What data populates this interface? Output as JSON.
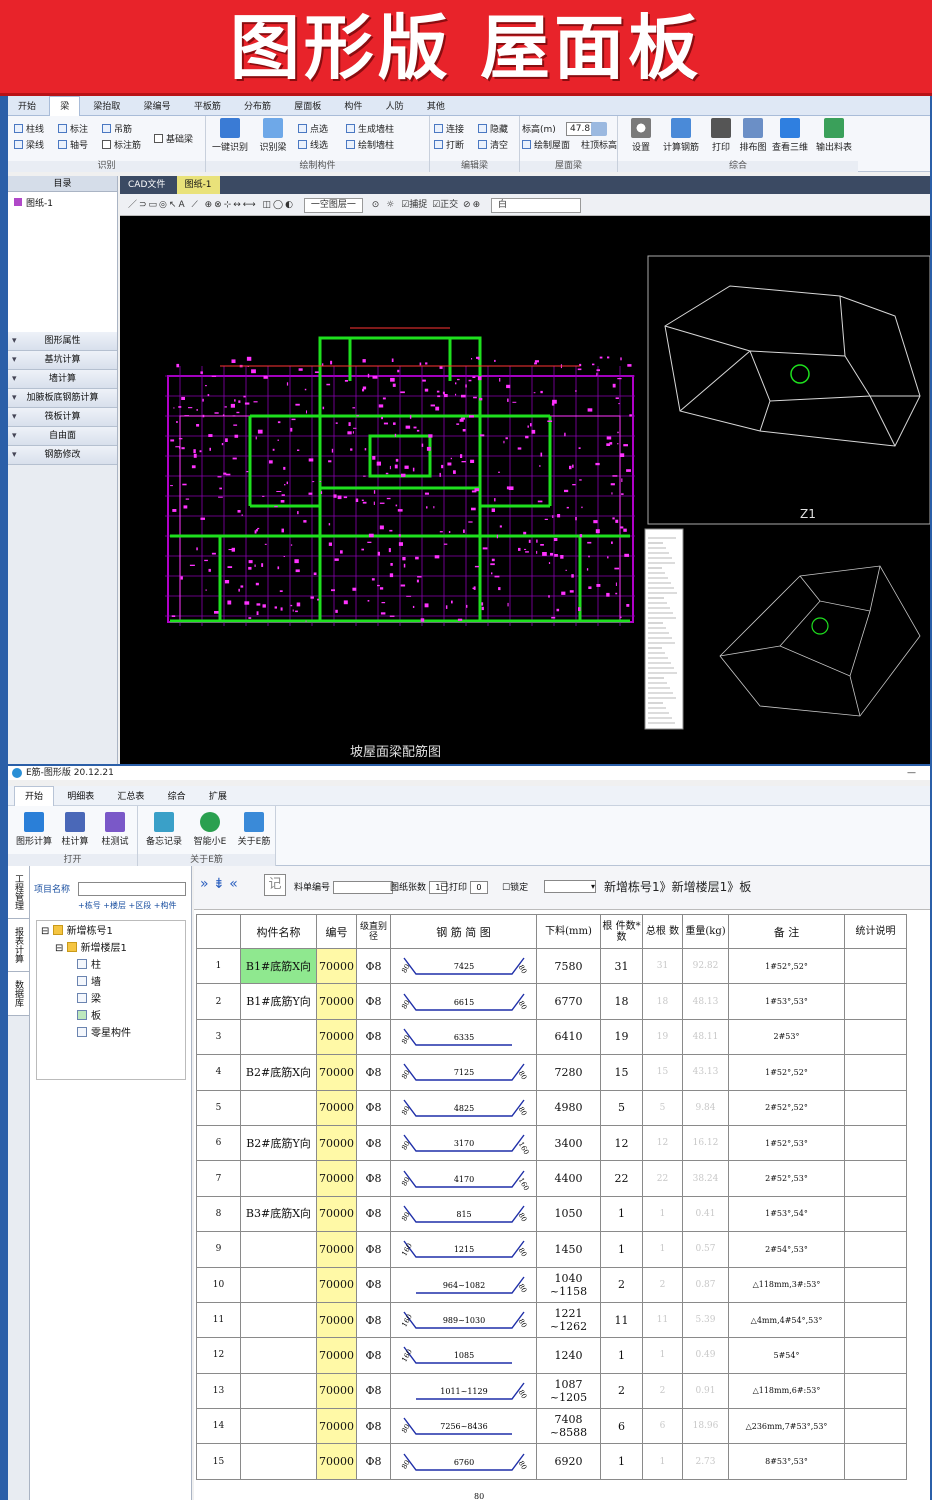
{
  "banner": {
    "title": "图形版  屋面板"
  },
  "top": {
    "menu": [
      "开始",
      "梁",
      "梁抬取",
      "梁编号",
      "平板筋",
      "分布筋",
      "屋面板",
      "构件",
      "人防",
      "其他"
    ],
    "menu_active": 1,
    "ribbon": {
      "recognize": {
        "label": "识别",
        "items": [
          "柱线",
          "标注",
          "吊筋",
          "基础梁",
          "梁线",
          "轴号",
          "标注筋"
        ]
      },
      "draw": {
        "label": "绘制构件",
        "items": [
          "一键识别",
          "识别梁",
          "点选",
          "线选",
          "生成墙柱",
          "绘制墙柱"
        ]
      },
      "edit": {
        "label": "编辑梁",
        "items": [
          "连接",
          "打断",
          "隐藏",
          "清空"
        ]
      },
      "roof": {
        "label": "屋面梁",
        "items": [
          "标高(m)",
          "47.8",
          "绘制屋面",
          "柱顶标高"
        ]
      },
      "combo": {
        "label": "综合",
        "items": [
          "设置",
          "计算钢筋",
          "打印",
          "排布图",
          "查看三维",
          "输出料表"
        ]
      }
    },
    "left_panel": {
      "header": "目录",
      "tree_item": "图纸-1",
      "sections": [
        "图形属性",
        "基坑计算",
        "墙计算",
        "加腋板底钢筋计算",
        "筏板计算",
        "自由面",
        "钢筋修改"
      ]
    },
    "doc_tabs": [
      "CAD文件",
      "图纸-1"
    ],
    "cad_toolbar": {
      "layer": "一空图层一",
      "snap": "捕捉",
      "ortho": "正交",
      "color": "白"
    },
    "drawing_caption": "坡屋面梁配筋图",
    "view_label": "Z1"
  },
  "bottom": {
    "title": "E筋-图形版 20.12.21",
    "menu": [
      "开始",
      "明细表",
      "汇总表",
      "综合",
      "扩展"
    ],
    "ribbon": {
      "open": {
        "label": "打开",
        "items": [
          "图形计算",
          "柱计算",
          "柱测试"
        ]
      },
      "about": {
        "label": "关于E筋",
        "items": [
          "备忘记录",
          "智能小E",
          "关于E筋"
        ]
      }
    },
    "vtabs": [
      "工程管理",
      "报表计算",
      "数据库"
    ],
    "project": {
      "label": "项目名称",
      "links": "+栋号 +楼层 +区段 +构件"
    },
    "tree": [
      "新增栋号1",
      "新增楼层1",
      "柱",
      "墙",
      "梁",
      "板",
      "零星构件"
    ],
    "grid_toolbar": {
      "material_no": "料单编号",
      "print_count_label": "图纸张数",
      "print_count": "1",
      "printed_label": "已打印",
      "printed": "0",
      "lock": "锁定",
      "record": "记",
      "crumb": "新增栋号1》新增楼层1》板"
    },
    "columns": [
      "构件名称",
      "编号",
      "级直别径",
      "钢 筋 简 图",
      "下料(mm)",
      "根 件数*数",
      "总根 数",
      "重量(kg)",
      "备  注",
      "统计说明"
    ],
    "rows": [
      {
        "idx": "1",
        "name": "B1#底筋X向",
        "code": "70000",
        "grade": "Φ8",
        "dims": [
          "80",
          "7425",
          "80"
        ],
        "len": "7580",
        "cnt": "31",
        "total": "31",
        "wt": "92.82",
        "note": "1#52°,52°"
      },
      {
        "idx": "2",
        "name": "B1#底筋Y向",
        "code": "70000",
        "grade": "Φ8",
        "dims": [
          "80",
          "6615",
          "80"
        ],
        "len": "6770",
        "cnt": "18",
        "total": "18",
        "wt": "48.13",
        "note": "1#53°,53°"
      },
      {
        "idx": "3",
        "name": "",
        "code": "70000",
        "grade": "Φ8",
        "dims": [
          "80",
          "6335",
          ""
        ],
        "len": "6410",
        "cnt": "19",
        "total": "19",
        "wt": "48.11",
        "note": "2#53°"
      },
      {
        "idx": "4",
        "name": "B2#底筋X向",
        "code": "70000",
        "grade": "Φ8",
        "dims": [
          "80",
          "7125",
          "80"
        ],
        "len": "7280",
        "cnt": "15",
        "total": "15",
        "wt": "43.13",
        "note": "1#52°,52°"
      },
      {
        "idx": "5",
        "name": "",
        "code": "70000",
        "grade": "Φ8",
        "dims": [
          "80",
          "4825",
          "80"
        ],
        "len": "4980",
        "cnt": "5",
        "total": "5",
        "wt": "9.84",
        "note": "2#52°,52°"
      },
      {
        "idx": "6",
        "name": "B2#底筋Y向",
        "code": "70000",
        "grade": "Φ8",
        "dims": [
          "80",
          "3170",
          "160"
        ],
        "len": "3400",
        "cnt": "12",
        "total": "12",
        "wt": "16.12",
        "note": "1#52°,53°"
      },
      {
        "idx": "7",
        "name": "",
        "code": "70000",
        "grade": "Φ8",
        "dims": [
          "80",
          "4170",
          "160"
        ],
        "len": "4400",
        "cnt": "22",
        "total": "22",
        "wt": "38.24",
        "note": "2#52°,53°"
      },
      {
        "idx": "8",
        "name": "B3#底筋X向",
        "code": "70000",
        "grade": "Φ8",
        "dims": [
          "80",
          "815",
          "80"
        ],
        "len": "1050",
        "cnt": "1",
        "total": "1",
        "wt": "0.41",
        "note": "1#53°,54°"
      },
      {
        "idx": "9",
        "name": "",
        "code": "70000",
        "grade": "Φ8",
        "dims": [
          "160",
          "1215",
          "80"
        ],
        "len": "1450",
        "cnt": "1",
        "total": "1",
        "wt": "0.57",
        "note": "2#54°,53°"
      },
      {
        "idx": "10",
        "name": "",
        "code": "70000",
        "grade": "Φ8",
        "dims": [
          "",
          "964~1082",
          "80"
        ],
        "len": "1040~1158",
        "cnt": "2",
        "total": "2",
        "wt": "0.87",
        "note": "△118mm,3#:53°"
      },
      {
        "idx": "11",
        "name": "",
        "code": "70000",
        "grade": "Φ8",
        "dims": [
          "160",
          "989~1030",
          "80"
        ],
        "len": "1221~1262",
        "cnt": "11",
        "total": "11",
        "wt": "5.39",
        "note": "△4mm,4#54°,53°"
      },
      {
        "idx": "12",
        "name": "",
        "code": "70000",
        "grade": "Φ8",
        "dims": [
          "160",
          "1085",
          ""
        ],
        "len": "1240",
        "cnt": "1",
        "total": "1",
        "wt": "0.49",
        "note": "5#54°"
      },
      {
        "idx": "13",
        "name": "",
        "code": "70000",
        "grade": "Φ8",
        "dims": [
          "",
          "1011~1129",
          "80"
        ],
        "len": "1087~1205",
        "cnt": "2",
        "total": "2",
        "wt": "0.91",
        "note": "△118mm,6#:53°"
      },
      {
        "idx": "14",
        "name": "",
        "code": "70000",
        "grade": "Φ8",
        "dims": [
          "80",
          "7256~8436",
          ""
        ],
        "len": "7408~8588",
        "cnt": "6",
        "total": "6",
        "wt": "18.96",
        "note": "△236mm,7#53°,53°"
      },
      {
        "idx": "15",
        "name": "",
        "code": "70000",
        "grade": "Φ8",
        "dims": [
          "80",
          "6760",
          "80"
        ],
        "len": "6920",
        "cnt": "1",
        "total": "1",
        "wt": "2.73",
        "note": "8#53°,53°"
      }
    ],
    "partial_dim": "80"
  },
  "colors": {
    "banner": "#e8232a",
    "beam_green": "#1ee01e",
    "rebar_magenta": "#ff33ff",
    "grid_line": "#b000c8",
    "rebar_line": "#1f2fa8"
  }
}
